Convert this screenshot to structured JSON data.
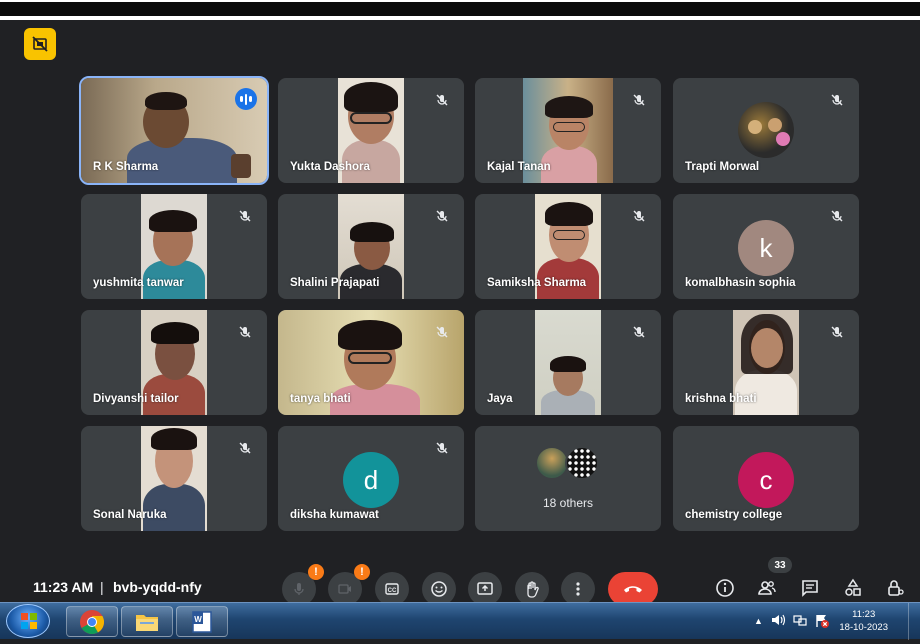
{
  "meeting": {
    "time": "11:23 AM",
    "separator": "|",
    "code": "bvb-yqdd-nfy",
    "people_count": "33",
    "warn_mark": "!"
  },
  "participants": [
    {
      "name": "R K Sharma",
      "type": "video",
      "speaking": true
    },
    {
      "name": "Yukta Dashora",
      "type": "video",
      "muted": true
    },
    {
      "name": "Kajal Tanan",
      "type": "video",
      "muted": true
    },
    {
      "name": "Trapti Morwal",
      "type": "avatar-photo",
      "muted": true
    },
    {
      "name": "yushmita tanwar",
      "type": "video",
      "muted": true
    },
    {
      "name": "Shalini Prajapati",
      "type": "video",
      "muted": true
    },
    {
      "name": "Samiksha Sharma",
      "type": "video",
      "muted": true
    },
    {
      "name": "komalbhasin sophia",
      "type": "avatar",
      "initial": "k",
      "color": "#a1887f",
      "muted": true
    },
    {
      "name": "Divyanshi tailor",
      "type": "video",
      "muted": true
    },
    {
      "name": "tanya bhati",
      "type": "video",
      "muted": true
    },
    {
      "name": "Jaya",
      "type": "video",
      "muted": true
    },
    {
      "name": "krishna bhati",
      "type": "video",
      "muted": true
    },
    {
      "name": "Sonal Naruka",
      "type": "video",
      "muted": true
    },
    {
      "name": "diksha kumawat",
      "type": "avatar",
      "initial": "d",
      "color": "#12939a",
      "muted": true
    },
    {
      "name": "18 others",
      "type": "others"
    },
    {
      "name": "chemistry college",
      "type": "avatar",
      "initial": "c",
      "color": "#c2185b"
    }
  ],
  "controls": {
    "microphone_icon": "mic-off-icon",
    "camera_icon": "camera-off-icon",
    "captions_icon": "closed-captions-icon",
    "reactions_icon": "emoji-icon",
    "present_icon": "present-screen-icon",
    "raise_hand_icon": "hand-icon",
    "more_icon": "more-options-icon",
    "leave_icon": "end-call-icon",
    "leave_color": "#ea4335"
  },
  "taskbar": {
    "time": "11:23",
    "date": "18-10-2023"
  },
  "colors": {
    "meet_bg": "#202124",
    "tile_bg": "#3c4043",
    "active_border": "#8ab4f8",
    "speaking_badge": "#1a73e8",
    "flag": "#f9c300"
  }
}
